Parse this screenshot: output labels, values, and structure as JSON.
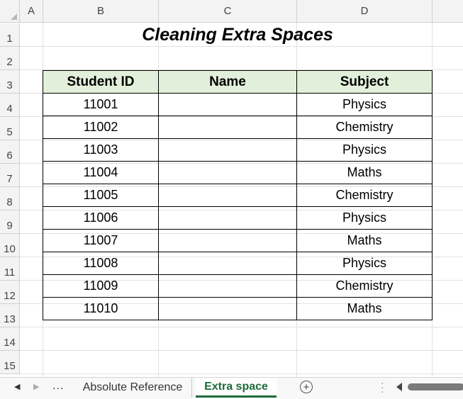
{
  "columns": [
    "A",
    "B",
    "C",
    "D"
  ],
  "rows": [
    "1",
    "2",
    "3",
    "4",
    "5",
    "6",
    "7",
    "8",
    "9",
    "10",
    "11",
    "12",
    "13",
    "14",
    "15"
  ],
  "title": "Cleaning Extra Spaces",
  "table": {
    "headers": [
      "Student ID",
      "Name",
      "Subject"
    ],
    "rows": [
      [
        "11001",
        "",
        "Physics"
      ],
      [
        "11002",
        "",
        "Chemistry"
      ],
      [
        "11003",
        "",
        "Physics"
      ],
      [
        "11004",
        "",
        "Maths"
      ],
      [
        "11005",
        "",
        "Chemistry"
      ],
      [
        "11006",
        "",
        "Physics"
      ],
      [
        "11007",
        "",
        "Maths"
      ],
      [
        "11008",
        "",
        "Physics"
      ],
      [
        "11009",
        "",
        "Chemistry"
      ],
      [
        "11010",
        "",
        "Maths"
      ]
    ]
  },
  "tabs": {
    "nav_prev": "◀",
    "nav_next": "▶",
    "more": "...",
    "sheets": [
      "Absolute Reference",
      "Extra space"
    ],
    "active": "Extra space",
    "add": "+"
  },
  "colors": {
    "header_fill": "#e2efda",
    "active_tab": "#1e6b3a"
  }
}
